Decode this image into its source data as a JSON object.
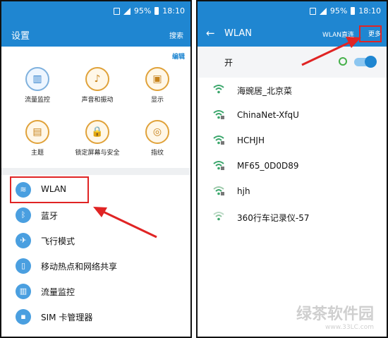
{
  "status": {
    "battery": "95%",
    "time": "18:10"
  },
  "left": {
    "title": "设置",
    "search": "搜索",
    "edit": "编辑",
    "grid": [
      {
        "label": "流量监控",
        "icon": "data-usage-icon",
        "glyph": "▥"
      },
      {
        "label": "声音和振动",
        "icon": "speaker-icon",
        "glyph": "♪"
      },
      {
        "label": "显示",
        "icon": "display-icon",
        "glyph": "▣"
      },
      {
        "label": "主题",
        "icon": "theme-icon",
        "glyph": "▤"
      },
      {
        "label": "锁定屏幕与安全",
        "icon": "lock-icon",
        "glyph": "🔒"
      },
      {
        "label": "指纹",
        "icon": "fingerprint-icon",
        "glyph": "◎"
      }
    ],
    "list": [
      {
        "label": "WLAN",
        "icon": "wifi-icon",
        "glyph": "≋"
      },
      {
        "label": "蓝牙",
        "icon": "bluetooth-icon",
        "glyph": "ᛒ"
      },
      {
        "label": "飞行模式",
        "icon": "airplane-icon",
        "glyph": "✈"
      },
      {
        "label": "移动热点和网络共享",
        "icon": "hotspot-icon",
        "glyph": "▯"
      },
      {
        "label": "流量监控",
        "icon": "data-usage-icon",
        "glyph": "▥"
      },
      {
        "label": "SIM 卡管理器",
        "icon": "sim-icon",
        "glyph": "▪"
      }
    ]
  },
  "right": {
    "title": "WLAN",
    "direct": "WLAN直连",
    "more": "更多",
    "toggle_label": "开",
    "networks": [
      "海豌居_北京菜",
      "ChinaNet-XfqU",
      "HCHJH",
      "MF65_0D0D89",
      "hjh",
      "360行车记录仪-57"
    ]
  },
  "watermark": {
    "title": "绿茶软件园",
    "url": "www.33LC.com"
  },
  "colors": {
    "accent": "#1f86d1",
    "highlight": "#e02424"
  }
}
